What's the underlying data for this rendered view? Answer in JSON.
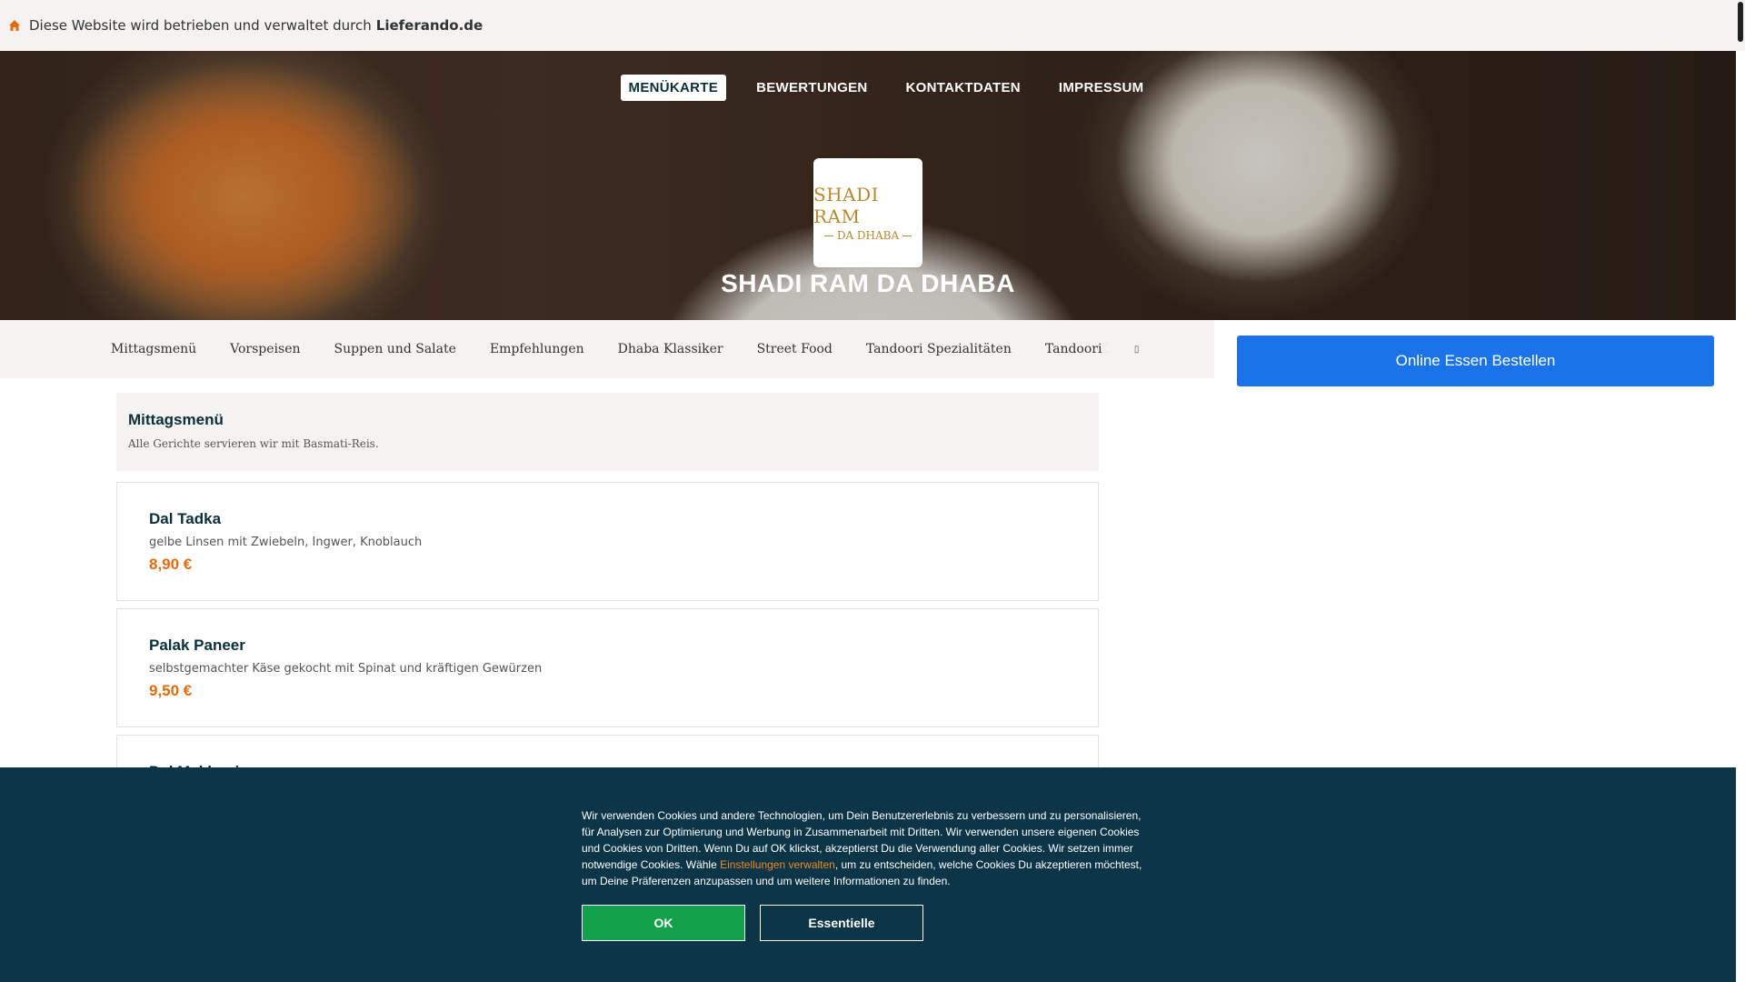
{
  "topbar": {
    "notice": "Diese Website wird betrieben und verwaltet durch",
    "brand": "Lieferando.de",
    "icon": "home-icon"
  },
  "nav": {
    "items": [
      "MENÜKARTE",
      "BEWERTUNGEN",
      "KONTAKTDATEN",
      "IMPRESSUM"
    ],
    "active": "MENÜKARTE"
  },
  "logo": {
    "line1": "SHADI RAM",
    "line2": "DA DHABA"
  },
  "restaurant": {
    "name": "SHADI RAM DA DHABA"
  },
  "categories": [
    "Mittagsmenü",
    "Vorspeisen",
    "Suppen und Salate",
    "Empfehlungen",
    "Dhaba Klassiker",
    "Street Food",
    "Tandoori Spezialitäten",
    "Tandoori B"
  ],
  "order_button": "Online Essen Bestellen",
  "section": {
    "title": "Mittagsmenü",
    "subtitle": "Alle Gerichte servieren wir mit Basmati-Reis."
  },
  "items": [
    {
      "name": "Dal Tadka",
      "description": "gelbe Linsen mit Zwiebeln, Ingwer, Knoblauch",
      "price": "8,90 €"
    },
    {
      "name": "Palak Paneer",
      "description": "selbstgemachter Käse gekocht mit Spinat und kräftigen Gewürzen",
      "price": "9,50 €"
    },
    {
      "name": "Dal Makhani",
      "description": "",
      "price": ""
    }
  ],
  "cookie": {
    "text_before": "Wir verwenden Cookies und andere Technologien, um Dein Benutzererlebnis zu verbessern und zu personalisieren, für Analysen zur Optimierung und Werbung in Zusammenarbeit mit Dritten. Wir verwenden unsere eigenen Cookies und Cookies von Dritten. Wenn Du auf OK klickst, akzeptierst Du die Verwendung aller Cookies. Wir setzen immer notwendige Cookies. Wähle ",
    "link": "Einstellungen verwalten",
    "text_after": ", um zu entscheiden, welche Cookies Du akzeptieren möchtest, um Deine Präferenzen anzupassen und um weitere Informationen zu finden.",
    "ok_label": "OK",
    "essential_label": "Essentielle"
  },
  "colors": {
    "accent_blue": "#1a73e8",
    "price_orange": "#e46a0b",
    "cookie_bg": "#0c3547",
    "ok_green": "#12a04b"
  }
}
